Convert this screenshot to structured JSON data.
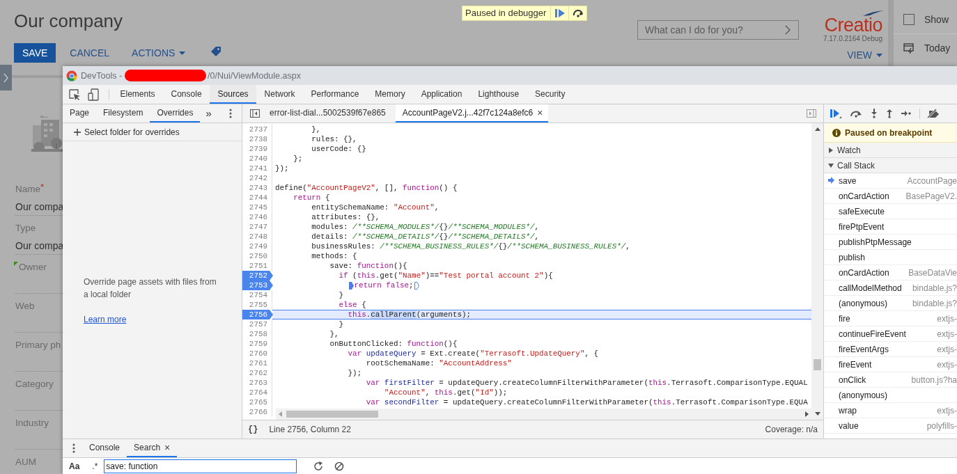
{
  "app": {
    "title": "Our company",
    "actions": [
      {
        "label": "SAVE",
        "kind": "primary"
      },
      {
        "label": "CANCEL",
        "kind": "link"
      },
      {
        "label": "ACTIONS",
        "kind": "menu"
      }
    ],
    "search": {
      "placeholder": "What can I do for you?"
    },
    "logo": "Creatio",
    "version": "7.17.0.2164 Debug",
    "view": "VIEW",
    "fields": [
      {
        "label": "Name",
        "required_mark": "*",
        "value": "Our compa",
        "marked": false
      },
      {
        "label": "Type",
        "value": "Our compa",
        "marked": false
      },
      {
        "label": "Owner",
        "marked": true
      },
      {
        "label": "Web",
        "marked": false
      },
      {
        "label": "Primary ph",
        "marked": false
      },
      {
        "label": "Category",
        "marked": false
      },
      {
        "label": "Industry",
        "marked": false
      },
      {
        "label": "AUM",
        "marked": false
      }
    ],
    "side_panel": {
      "show": {
        "label": "Show",
        "checked": false
      },
      "today": "Today"
    }
  },
  "debugger_banner": {
    "label": "Paused in debugger"
  },
  "devtools": {
    "title_prefix": "DevTools -",
    "title_suffix": "/0/Nui/ViewModule.aspx",
    "tabs": [
      {
        "label": "Elements",
        "selected": false
      },
      {
        "label": "Console",
        "selected": false
      },
      {
        "label": "Sources",
        "selected": true
      },
      {
        "label": "Network",
        "selected": false
      },
      {
        "label": "Performance",
        "selected": false
      },
      {
        "label": "Memory",
        "selected": false
      },
      {
        "label": "Application",
        "selected": false
      },
      {
        "label": "Lighthouse",
        "selected": false
      },
      {
        "label": "Security",
        "selected": false
      }
    ],
    "navigator": {
      "tabs": [
        {
          "label": "Page",
          "selected": false
        },
        {
          "label": "Filesystem",
          "selected": false
        },
        {
          "label": "Overrides",
          "selected": true
        }
      ],
      "more": "»",
      "add_folder": "Select folder for overrides",
      "message": "Override page assets with files from a local folder",
      "link": "Learn more"
    },
    "editor": {
      "tabs": [
        {
          "label": "error-list-dial...5002539f67e865",
          "selected": false
        },
        {
          "label": "AccountPageV2.j...42f7c124a8efc6",
          "selected": true,
          "close": "×"
        }
      ],
      "lines": [
        {
          "number": "2737",
          "breakpoint": false,
          "current": false,
          "tokens": [
            {
              "text": "        },",
              "kind": "plain"
            }
          ]
        },
        {
          "number": "2738",
          "breakpoint": false,
          "current": false,
          "tokens": [
            {
              "text": "        rules: {},",
              "kind": "plain"
            }
          ]
        },
        {
          "number": "2739",
          "breakpoint": false,
          "current": false,
          "tokens": [
            {
              "text": "        userCode: {}",
              "kind": "plain"
            }
          ]
        },
        {
          "number": "2740",
          "breakpoint": false,
          "current": false,
          "tokens": [
            {
              "text": "    };",
              "kind": "plain"
            }
          ]
        },
        {
          "number": "2741",
          "breakpoint": false,
          "current": false,
          "tokens": [
            {
              "text": "});",
              "kind": "plain"
            }
          ]
        },
        {
          "number": "2742",
          "breakpoint": false,
          "current": false
        },
        {
          "number": "2743",
          "breakpoint": false,
          "current": false,
          "tokens": [
            {
              "text": "define(",
              "kind": "plain"
            },
            {
              "text": "\"AccountPageV2\"",
              "kind": "string"
            },
            {
              "text": ", [], ",
              "kind": "plain"
            },
            {
              "text": "function",
              "kind": "keyword"
            },
            {
              "text": "() {",
              "kind": "plain"
            }
          ]
        },
        {
          "number": "2744",
          "breakpoint": false,
          "current": false,
          "tokens": [
            {
              "text": "    return",
              "kind": "keyword"
            },
            {
              "text": " {",
              "kind": "plain"
            }
          ]
        },
        {
          "number": "2745",
          "breakpoint": false,
          "current": false,
          "tokens": [
            {
              "text": "        entitySchemaName: ",
              "kind": "plain"
            },
            {
              "text": "\"Account\"",
              "kind": "string"
            },
            {
              "text": ",",
              "kind": "plain"
            }
          ]
        },
        {
          "number": "2746",
          "breakpoint": false,
          "current": false,
          "tokens": [
            {
              "text": "        attributes: {},",
              "kind": "plain"
            }
          ]
        },
        {
          "number": "2747",
          "breakpoint": false,
          "current": false,
          "tokens": [
            {
              "text": "        modules: ",
              "kind": "plain"
            },
            {
              "text": "/**SCHEMA_MODULES*/",
              "kind": "comment"
            },
            {
              "text": "{}",
              "kind": "plain"
            },
            {
              "text": "/**SCHEMA_MODULES*/",
              "kind": "comment"
            },
            {
              "text": ",",
              "kind": "plain"
            }
          ]
        },
        {
          "number": "2748",
          "breakpoint": false,
          "current": false,
          "tokens": [
            {
              "text": "        details: ",
              "kind": "plain"
            },
            {
              "text": "/**SCHEMA_DETAILS*/",
              "kind": "comment"
            },
            {
              "text": "{}",
              "kind": "plain"
            },
            {
              "text": "/**SCHEMA_DETAILS*/",
              "kind": "comment"
            },
            {
              "text": ",",
              "kind": "plain"
            }
          ]
        },
        {
          "number": "2749",
          "breakpoint": false,
          "current": false,
          "tokens": [
            {
              "text": "        businessRules: ",
              "kind": "plain"
            },
            {
              "text": "/**SCHEMA_BUSINESS_RULES*/",
              "kind": "comment"
            },
            {
              "text": "{}",
              "kind": "plain"
            },
            {
              "text": "/**SCHEMA_BUSINESS_RULES*/",
              "kind": "comment"
            },
            {
              "text": ",",
              "kind": "plain"
            }
          ]
        },
        {
          "number": "2750",
          "breakpoint": false,
          "current": false,
          "tokens": [
            {
              "text": "        methods: {",
              "kind": "plain"
            }
          ]
        },
        {
          "number": "2751",
          "breakpoint": false,
          "current": false,
          "tokens": [
            {
              "text": "            save: ",
              "kind": "plain"
            },
            {
              "text": "function",
              "kind": "keyword"
            },
            {
              "text": "(){",
              "kind": "plain"
            }
          ]
        },
        {
          "number": "2752",
          "breakpoint": true,
          "current": false,
          "tokens": [
            {
              "text": "              if",
              "kind": "keyword"
            },
            {
              "text": " (",
              "kind": "plain"
            },
            {
              "text": "this",
              "kind": "keyword"
            },
            {
              "text": ".get(",
              "kind": "plain"
            },
            {
              "text": "\"Name\"",
              "kind": "string"
            },
            {
              "text": ")==",
              "kind": "plain"
            },
            {
              "text": "\"Test portal account 2\"",
              "kind": "string"
            },
            {
              "text": "){",
              "kind": "plain"
            }
          ]
        },
        {
          "number": "2753",
          "breakpoint": true,
          "current": false,
          "tokens": [
            {
              "text": "                return",
              "kind": "keyword",
              "marker_before": true
            },
            {
              "text": " false",
              "kind": "keyword"
            },
            {
              "text": ";",
              "kind": "plain",
              "marker_after": true
            }
          ]
        },
        {
          "number": "2754",
          "breakpoint": false,
          "current": false,
          "tokens": [
            {
              "text": "              }",
              "kind": "plain"
            }
          ]
        },
        {
          "number": "2755",
          "breakpoint": false,
          "current": false,
          "tokens": [
            {
              "text": "              else",
              "kind": "keyword"
            },
            {
              "text": " {",
              "kind": "plain"
            }
          ]
        },
        {
          "number": "2756",
          "breakpoint": true,
          "current": true,
          "tokens": [
            {
              "text": "                this",
              "kind": "keyword"
            },
            {
              "text": ".",
              "kind": "plain"
            },
            {
              "text": "callParent",
              "kind": "selection"
            },
            {
              "text": "(arguments);",
              "kind": "plain"
            }
          ]
        },
        {
          "number": "2757",
          "breakpoint": false,
          "current": false,
          "tokens": [
            {
              "text": "              }",
              "kind": "plain"
            }
          ]
        },
        {
          "number": "2758",
          "breakpoint": false,
          "current": false,
          "tokens": [
            {
              "text": "            },",
              "kind": "plain"
            }
          ]
        },
        {
          "number": "2759",
          "breakpoint": false,
          "current": false,
          "tokens": [
            {
              "text": "            onButtonClicked: ",
              "kind": "plain"
            },
            {
              "text": "function",
              "kind": "keyword"
            },
            {
              "text": "(){",
              "kind": "plain"
            }
          ]
        },
        {
          "number": "2760",
          "breakpoint": false,
          "current": false,
          "tokens": [
            {
              "text": "                var",
              "kind": "keyword"
            },
            {
              "text": " updateQuery",
              "kind": "def"
            },
            {
              "text": " = Ext.create(",
              "kind": "plain"
            },
            {
              "text": "\"Terrasoft.UpdateQuery\"",
              "kind": "string"
            },
            {
              "text": ", {",
              "kind": "plain"
            }
          ]
        },
        {
          "number": "2761",
          "breakpoint": false,
          "current": false,
          "tokens": [
            {
              "text": "                    rootSchemaName: ",
              "kind": "plain"
            },
            {
              "text": "\"AccountAddress\"",
              "kind": "string"
            }
          ]
        },
        {
          "number": "2762",
          "breakpoint": false,
          "current": false,
          "tokens": [
            {
              "text": "                });",
              "kind": "plain"
            }
          ]
        },
        {
          "number": "2763",
          "breakpoint": false,
          "current": false,
          "tokens": [
            {
              "text": "                    var",
              "kind": "keyword"
            },
            {
              "text": " firstFilter",
              "kind": "def"
            },
            {
              "text": " = updateQuery.createColumnFilterWithParameter(",
              "kind": "plain"
            },
            {
              "text": "this",
              "kind": "keyword"
            },
            {
              "text": ".Terrasoft.ComparisonType.EQUAL",
              "kind": "plain"
            }
          ]
        },
        {
          "number": "2764",
          "breakpoint": false,
          "current": false,
          "tokens": [
            {
              "text": "                        \"Account\"",
              "kind": "string"
            },
            {
              "text": ", ",
              "kind": "plain"
            },
            {
              "text": "this",
              "kind": "keyword"
            },
            {
              "text": ".get(",
              "kind": "plain"
            },
            {
              "text": "\"Id\"",
              "kind": "string"
            },
            {
              "text": "));",
              "kind": "plain"
            }
          ]
        },
        {
          "number": "2765",
          "breakpoint": false,
          "current": false,
          "tokens": [
            {
              "text": "                    var",
              "kind": "keyword"
            },
            {
              "text": " secondFilter",
              "kind": "def"
            },
            {
              "text": " = updateQuery.createColumnFilterWithParameter(",
              "kind": "plain"
            },
            {
              "text": "this",
              "kind": "keyword"
            },
            {
              "text": ".Terrasoft.ComparisonType.EQUA",
              "kind": "plain"
            }
          ]
        },
        {
          "number": "2766",
          "breakpoint": false,
          "current": false
        }
      ],
      "status": {
        "pretty_print": "{}",
        "position": "Line 2756, Column 22",
        "coverage": "Coverage: n/a"
      }
    },
    "sidebar": {
      "banner": "Paused on breakpoint",
      "sections": [
        {
          "label": "Watch",
          "expanded": false
        },
        {
          "label": "Call Stack",
          "expanded": true,
          "frames": [
            {
              "name": "save",
              "location": "AccountPage",
              "current": true
            },
            {
              "name": "onCardAction",
              "location": "BasePageV2.",
              "current": false
            },
            {
              "name": "safeExecute",
              "current": false
            },
            {
              "name": "firePtpEvent",
              "current": false
            },
            {
              "name": "publishPtpMessage",
              "current": false
            },
            {
              "name": "publish",
              "current": false
            },
            {
              "name": "onCardAction",
              "location": "BaseDataVie",
              "current": false
            },
            {
              "name": "callModelMethod",
              "location": "bindable.js?",
              "current": false
            },
            {
              "name": "(anonymous)",
              "location": "bindable.js?",
              "current": false
            },
            {
              "name": "fire",
              "location": "extjs-",
              "current": false
            },
            {
              "name": "continueFireEvent",
              "location": "extjs-",
              "current": false
            },
            {
              "name": "fireEventArgs",
              "location": "extjs-",
              "current": false
            },
            {
              "name": "fireEvent",
              "location": "extjs-",
              "current": false
            },
            {
              "name": "onClick",
              "location": "button.js?ha",
              "current": false
            },
            {
              "name": "(anonymous)",
              "current": false
            },
            {
              "name": "wrap",
              "location": "extjs-",
              "current": false
            },
            {
              "name": "value",
              "location": "polyfills-",
              "current": false
            }
          ]
        }
      ]
    },
    "drawer": {
      "tabs": [
        {
          "label": "Console",
          "selected": false
        },
        {
          "label": "Search",
          "selected": true,
          "close": "×"
        }
      ],
      "search": {
        "match_case": "Aa",
        "regex": ".*",
        "value": "save: function"
      }
    }
  }
}
